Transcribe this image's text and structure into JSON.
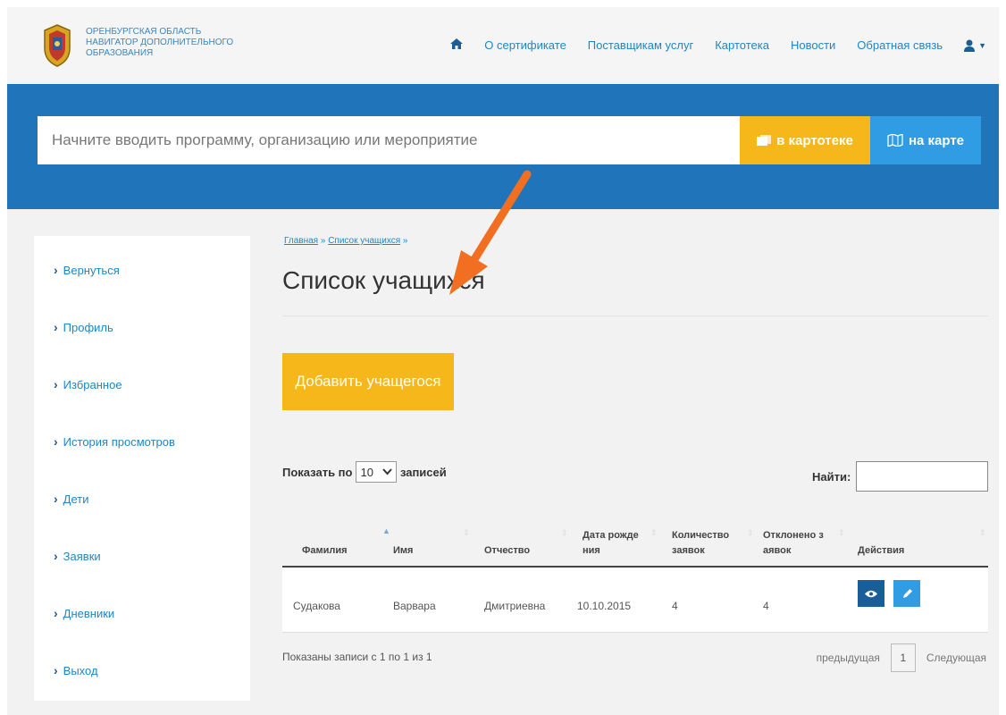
{
  "brand": {
    "line1": "ОРЕНБУРГСКАЯ ОБЛАСТЬ",
    "line2": "НАВИГАТОР ДОПОЛНИТЕЛЬНОГО",
    "line3": "ОБРАЗОВАНИЯ"
  },
  "nav": {
    "items": [
      "О сертификате",
      "Поставщикам услуг",
      "Картотека",
      "Новости",
      "Обратная связь"
    ],
    "home_icon": "home-icon",
    "user_icon": "user-icon"
  },
  "search": {
    "placeholder": "Начните вводить программу, организацию или мероприятие",
    "catalog_button": "в картотеке",
    "map_button": "на карте"
  },
  "sidebar": {
    "items": [
      "Вернуться",
      "Профиль",
      "Избранное",
      "История просмотров",
      "Дети",
      "Заявки",
      "Дневники",
      "Выход"
    ]
  },
  "breadcrumb": {
    "home": "Главная",
    "current": "Список учащихся",
    "separator": "»"
  },
  "page_title": "Список учащихся",
  "add_button": "Добавить учащегося",
  "table_controls": {
    "show_prefix": "Показать по",
    "page_size": "10",
    "show_suffix": "записей",
    "search_label": "Найти:"
  },
  "table": {
    "columns": [
      {
        "line1": "Фамилия",
        "line2": ""
      },
      {
        "line1": "Имя",
        "line2": ""
      },
      {
        "line1": "Отчество",
        "line2": ""
      },
      {
        "line1": "Дата рожде",
        "line2": "ния"
      },
      {
        "line1": "Количество",
        "line2": "заявок"
      },
      {
        "line1": "Отклонено з",
        "line2": "аявок"
      },
      {
        "line1": "Действия",
        "line2": ""
      }
    ],
    "rows": [
      {
        "surname": "Судакова",
        "name": "Варвара",
        "patronymic": "Дмитриевна",
        "birth": "10.10.2015",
        "requests": "4",
        "rejected": "4"
      }
    ]
  },
  "footer": {
    "info": "Показаны записи с 1 по 1 из 1",
    "prev": "предыдущая",
    "page": "1",
    "next": "Следующая"
  },
  "colors": {
    "brand_blue": "#1f74ba",
    "accent_yellow": "#f5b719",
    "link_blue": "#1f86c4",
    "annotation_orange": "#f26f21"
  }
}
